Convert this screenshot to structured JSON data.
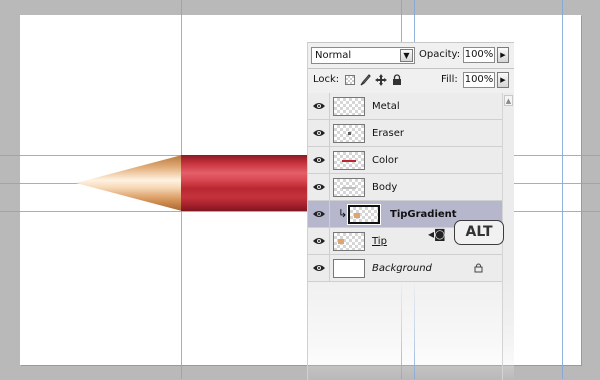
{
  "layers_panel": {
    "blend_mode": "Normal",
    "opacity_label": "Opacity:",
    "opacity_value": "100%",
    "lock_label": "Lock:",
    "fill_label": "Fill:",
    "fill_value": "100%",
    "arrow_glyph": "▶",
    "dropdown_glyph": "▼",
    "layers": [
      {
        "name": "Metal",
        "visible": true
      },
      {
        "name": "Eraser",
        "visible": true
      },
      {
        "name": "Color",
        "visible": true
      },
      {
        "name": "Body",
        "visible": true
      },
      {
        "name": "TipGradient",
        "visible": true,
        "selected": true,
        "clipped": true
      },
      {
        "name": "Tip",
        "visible": true
      },
      {
        "name": "Background",
        "visible": true,
        "locked": true
      }
    ]
  },
  "modifier_badge": "ALT",
  "colors": {
    "selection": "#b6b6cd",
    "guide": "#7ea6d8",
    "pencil_red": "#c8343f"
  }
}
